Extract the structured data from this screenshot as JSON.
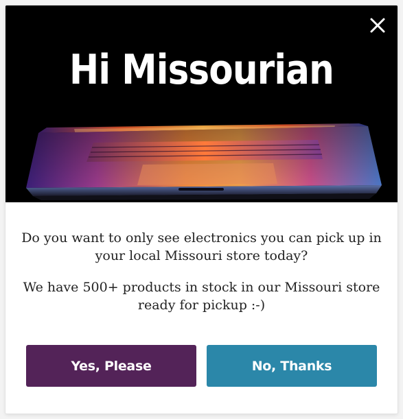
{
  "popup": {
    "title": "Hi Missourian",
    "close_icon": "close-icon",
    "hero_image": "laptop-image",
    "message_primary": "Do you want to only see electronics you can pick up in your local Missouri store today?",
    "message_secondary": "We have 500+ products in stock in our Missouri store ready for pickup :-)",
    "yes_label": "Yes, Please",
    "no_label": "No, Thanks"
  },
  "colors": {
    "yes_button": "#532358",
    "no_button": "#2b87a9",
    "hero_background": "#000000"
  }
}
